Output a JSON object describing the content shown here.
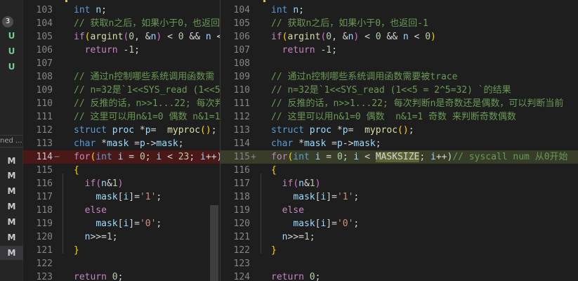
{
  "sidebar": {
    "badge": "3",
    "items": [
      {
        "label": "U",
        "color": "#73c991"
      },
      {
        "label": "U",
        "color": "#73c991"
      },
      {
        "label": "U",
        "color": "#73c991"
      },
      {
        "label": "M",
        "color": "#cccccc"
      },
      {
        "label": "M",
        "color": "#cccccc"
      },
      {
        "label": "M",
        "color": "#cccccc"
      },
      {
        "label": "M",
        "color": "#cccccc"
      },
      {
        "label": "M",
        "color": "#cccccc"
      },
      {
        "label": "M",
        "color": "#cccccc"
      },
      {
        "label": "M",
        "color": "#cccccc"
      }
    ],
    "section_label": "ned ..."
  },
  "left_pane": {
    "lines": [
      {
        "num": "103",
        "tokens": [
          [
            "kw",
            "int"
          ],
          [
            "op",
            " "
          ],
          [
            "var",
            "n"
          ],
          [
            "op",
            ";"
          ]
        ]
      },
      {
        "num": "104",
        "tokens": [
          [
            "cmt",
            "// 获取n之后，如果小于0，也返回"
          ]
        ]
      },
      {
        "num": "105",
        "tokens": [
          [
            "ctl",
            "if"
          ],
          [
            "brk2",
            "("
          ],
          [
            "fn",
            "argint"
          ],
          [
            "brk",
            "("
          ],
          [
            "num",
            "0"
          ],
          [
            "op",
            ", &"
          ],
          [
            "var",
            "n"
          ],
          [
            "brk",
            ")"
          ],
          [
            "op",
            " < "
          ],
          [
            "num",
            "0"
          ],
          [
            "op",
            " && "
          ],
          [
            "var",
            "n"
          ],
          [
            "op",
            " <"
          ]
        ]
      },
      {
        "num": "106",
        "tokens": [
          [
            "op",
            "  "
          ],
          [
            "ctl",
            "return"
          ],
          [
            "op",
            " -"
          ],
          [
            "num",
            "1"
          ],
          [
            "op",
            ";"
          ]
        ]
      },
      {
        "num": "107",
        "tokens": []
      },
      {
        "num": "108",
        "tokens": [
          [
            "cmt",
            "// 通过n控制哪些系统调用函数需"
          ]
        ]
      },
      {
        "num": "109",
        "tokens": [
          [
            "cmt",
            "// n=32是`1<<SYS_read (1<<5"
          ]
        ]
      },
      {
        "num": "110",
        "tokens": [
          [
            "cmt",
            "// 反推的话，n>>1...22; 每次判"
          ]
        ]
      },
      {
        "num": "111",
        "tokens": [
          [
            "cmt",
            "// 这里可以用n&1=0 偶数 n&1=1"
          ]
        ]
      },
      {
        "num": "112",
        "tokens": [
          [
            "kw",
            "struct"
          ],
          [
            "op",
            " "
          ],
          [
            "var",
            "proc"
          ],
          [
            "op",
            " *"
          ],
          [
            "var",
            "p"
          ],
          [
            "op",
            "=  "
          ],
          [
            "fn",
            "myproc"
          ],
          [
            "brk2",
            "()"
          ],
          [
            "op",
            ";"
          ]
        ]
      },
      {
        "num": "113",
        "tokens": [
          [
            "kw",
            "char"
          ],
          [
            "op",
            " *"
          ],
          [
            "var",
            "mask"
          ],
          [
            "op",
            " ="
          ],
          [
            "var",
            "p"
          ],
          [
            "op",
            "->"
          ],
          [
            "var",
            "mask"
          ],
          [
            "op",
            ";"
          ]
        ]
      },
      {
        "num": "114",
        "status": "removed",
        "tokens": [
          [
            "ctl",
            "for"
          ],
          [
            "brk2",
            "("
          ],
          [
            "kw",
            "int"
          ],
          [
            "op",
            " "
          ],
          [
            "var",
            "i"
          ],
          [
            "op",
            " = "
          ],
          [
            "num",
            "0"
          ],
          [
            "op",
            "; "
          ],
          [
            "var",
            "i"
          ],
          [
            "op",
            " < "
          ],
          [
            "num",
            "23"
          ],
          [
            "op",
            "; "
          ],
          [
            "var",
            "i"
          ],
          [
            "op",
            "++)"
          ]
        ]
      },
      {
        "num": "115",
        "tokens": [
          [
            "brk2",
            "{"
          ]
        ]
      },
      {
        "num": "116",
        "tokens": [
          [
            "op",
            "  "
          ],
          [
            "ctl",
            "if"
          ],
          [
            "brk",
            "("
          ],
          [
            "var",
            "n"
          ],
          [
            "op",
            "&"
          ],
          [
            "num",
            "1"
          ],
          [
            "brk",
            ")"
          ]
        ]
      },
      {
        "num": "117",
        "tokens": [
          [
            "op",
            "    "
          ],
          [
            "var",
            "mask"
          ],
          [
            "op",
            "["
          ],
          [
            "var",
            "i"
          ],
          [
            "op",
            "]="
          ],
          [
            "str",
            "'1'"
          ],
          [
            "op",
            ";"
          ]
        ]
      },
      {
        "num": "118",
        "tokens": [
          [
            "op",
            "  "
          ],
          [
            "ctl",
            "else"
          ]
        ]
      },
      {
        "num": "119",
        "tokens": [
          [
            "op",
            "    "
          ],
          [
            "var",
            "mask"
          ],
          [
            "op",
            "["
          ],
          [
            "var",
            "i"
          ],
          [
            "op",
            "]="
          ],
          [
            "str",
            "'0'"
          ],
          [
            "op",
            ";"
          ]
        ]
      },
      {
        "num": "120",
        "tokens": [
          [
            "op",
            "  "
          ],
          [
            "var",
            "n"
          ],
          [
            "op",
            ">>="
          ],
          [
            "num",
            "1"
          ],
          [
            "op",
            ";"
          ]
        ]
      },
      {
        "num": "121",
        "tokens": [
          [
            "brk2",
            "}"
          ]
        ]
      },
      {
        "num": "122",
        "tokens": []
      },
      {
        "num": "123",
        "tokens": [
          [
            "ctl",
            "return"
          ],
          [
            "op",
            " "
          ],
          [
            "num",
            "0"
          ],
          [
            "op",
            ";"
          ]
        ]
      }
    ]
  },
  "right_pane": {
    "lines": [
      {
        "num": "104",
        "tokens": [
          [
            "kw",
            "int"
          ],
          [
            "op",
            " "
          ],
          [
            "var",
            "n"
          ],
          [
            "op",
            ";"
          ]
        ]
      },
      {
        "num": "105",
        "tokens": [
          [
            "cmt",
            "// 获取n之后，如果小于0，也返回-1"
          ]
        ]
      },
      {
        "num": "106",
        "tokens": [
          [
            "ctl",
            "if"
          ],
          [
            "brk2",
            "("
          ],
          [
            "fn",
            "argint"
          ],
          [
            "brk",
            "("
          ],
          [
            "num",
            "0"
          ],
          [
            "op",
            ", &"
          ],
          [
            "var",
            "n"
          ],
          [
            "brk",
            ")"
          ],
          [
            "op",
            " < "
          ],
          [
            "num",
            "0"
          ],
          [
            "op",
            " && "
          ],
          [
            "var",
            "n"
          ],
          [
            "op",
            " < "
          ],
          [
            "num",
            "0"
          ],
          [
            "brk2",
            ")"
          ]
        ]
      },
      {
        "num": "107",
        "tokens": [
          [
            "op",
            "  "
          ],
          [
            "ctl",
            "return"
          ],
          [
            "op",
            " -"
          ],
          [
            "num",
            "1"
          ],
          [
            "op",
            ";"
          ]
        ]
      },
      {
        "num": "108",
        "tokens": []
      },
      {
        "num": "109",
        "tokens": [
          [
            "cmt",
            "// 通过n控制哪些系统调用函数需要被trace"
          ]
        ]
      },
      {
        "num": "110",
        "tokens": [
          [
            "cmt",
            "// n=32是`1<<SYS_read (1<<5 = 2^5=32) `的结果"
          ]
        ]
      },
      {
        "num": "111",
        "tokens": [
          [
            "cmt",
            "// 反推的话，n>>1...22; 每次判断n是奇数还是偶数，可以判断当前"
          ]
        ]
      },
      {
        "num": "112",
        "tokens": [
          [
            "cmt",
            "// 这里可以用n&1=0 偶数  n&1=1 奇数 来判断奇数偶数"
          ]
        ]
      },
      {
        "num": "113",
        "tokens": [
          [
            "kw",
            "struct"
          ],
          [
            "op",
            " "
          ],
          [
            "var",
            "proc"
          ],
          [
            "op",
            " *"
          ],
          [
            "var",
            "p"
          ],
          [
            "op",
            "=  "
          ],
          [
            "fn",
            "myproc"
          ],
          [
            "brk2",
            "()"
          ],
          [
            "op",
            ";"
          ]
        ]
      },
      {
        "num": "114",
        "tokens": [
          [
            "kw",
            "char"
          ],
          [
            "op",
            " *"
          ],
          [
            "var",
            "mask"
          ],
          [
            "op",
            " ="
          ],
          [
            "var",
            "p"
          ],
          [
            "op",
            "->"
          ],
          [
            "var",
            "mask"
          ],
          [
            "op",
            ";"
          ]
        ]
      },
      {
        "num": "115",
        "status": "added",
        "tokens": [
          [
            "ctl",
            "for"
          ],
          [
            "brk2",
            "("
          ],
          [
            "kw",
            "int"
          ],
          [
            "op",
            " "
          ],
          [
            "var",
            "i"
          ],
          [
            "op",
            " = "
          ],
          [
            "num",
            "0"
          ],
          [
            "op",
            "; "
          ],
          [
            "var",
            "i"
          ],
          [
            "op",
            " < "
          ],
          [
            "hl",
            "MASKSIZE"
          ],
          [
            "op",
            "; "
          ],
          [
            "var",
            "i"
          ],
          [
            "op",
            "++)"
          ],
          [
            "cmt",
            "// syscall num 从0开始"
          ]
        ]
      },
      {
        "num": "116",
        "tokens": [
          [
            "brk2",
            "{"
          ]
        ]
      },
      {
        "num": "117",
        "tokens": [
          [
            "op",
            "  "
          ],
          [
            "ctl",
            "if"
          ],
          [
            "brk",
            "("
          ],
          [
            "var",
            "n"
          ],
          [
            "op",
            "&"
          ],
          [
            "num",
            "1"
          ],
          [
            "brk",
            ")"
          ]
        ]
      },
      {
        "num": "118",
        "tokens": [
          [
            "op",
            "    "
          ],
          [
            "var",
            "mask"
          ],
          [
            "op",
            "["
          ],
          [
            "var",
            "i"
          ],
          [
            "op",
            "]="
          ],
          [
            "str",
            "'1'"
          ],
          [
            "op",
            ";"
          ]
        ]
      },
      {
        "num": "119",
        "tokens": [
          [
            "op",
            "  "
          ],
          [
            "ctl",
            "else"
          ]
        ]
      },
      {
        "num": "120",
        "tokens": [
          [
            "op",
            "    "
          ],
          [
            "var",
            "mask"
          ],
          [
            "op",
            "["
          ],
          [
            "var",
            "i"
          ],
          [
            "op",
            "]="
          ],
          [
            "str",
            "'0'"
          ],
          [
            "op",
            ";"
          ]
        ]
      },
      {
        "num": "121",
        "tokens": [
          [
            "op",
            "  "
          ],
          [
            "var",
            "n"
          ],
          [
            "op",
            ">>="
          ],
          [
            "num",
            "1"
          ],
          [
            "op",
            ";"
          ]
        ]
      },
      {
        "num": "122",
        "tokens": [
          [
            "brk2",
            "}"
          ]
        ]
      },
      {
        "num": "123",
        "tokens": []
      },
      {
        "num": "124",
        "tokens": [
          [
            "ctl",
            "return"
          ],
          [
            "op",
            " "
          ],
          [
            "num",
            "0"
          ],
          [
            "op",
            ";"
          ]
        ]
      }
    ]
  },
  "diff_markers": {
    "removed": "−",
    "added": "+"
  }
}
